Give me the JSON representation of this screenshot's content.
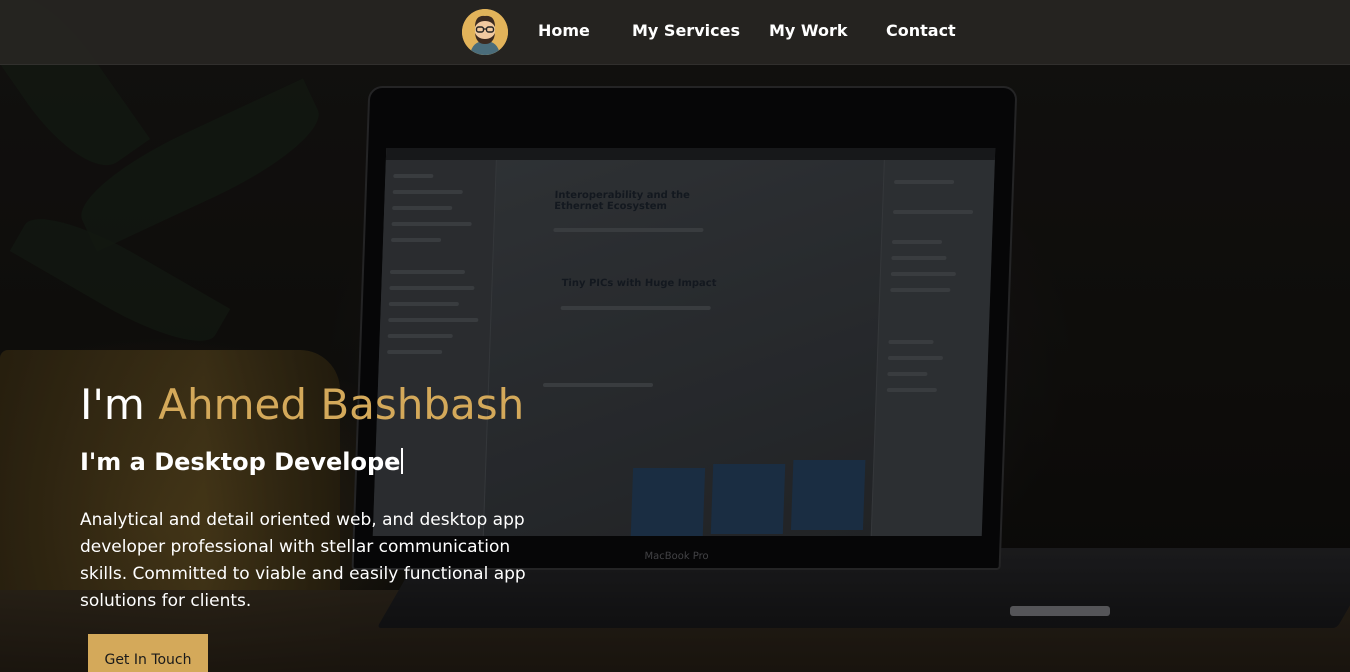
{
  "nav": {
    "avatar_icon": "avatar-icon",
    "links": [
      {
        "label": "Home"
      },
      {
        "label": "My Services"
      },
      {
        "label": "My Work"
      },
      {
        "label": "Contact"
      }
    ]
  },
  "hero": {
    "intro_prefix": "I'm",
    "name": "Ahmed Bashbash",
    "role_text": "I'm a Desktop Develope",
    "description": "Analytical and detail oriented web, and desktop app developer professional with stellar communication skills. Committed to viable and easily functional app solutions for clients.",
    "cta_label": "Get In Touch"
  },
  "background": {
    "laptop_screen_heading_1": "Interoperability and the Ethernet Ecosystem",
    "laptop_screen_heading_2": "Tiny PICs with Huge Impact",
    "laptop_label": "MacBook Pro"
  },
  "colors": {
    "accent": "#d4a95a",
    "navbar": "#282622",
    "text": "#ffffff"
  }
}
